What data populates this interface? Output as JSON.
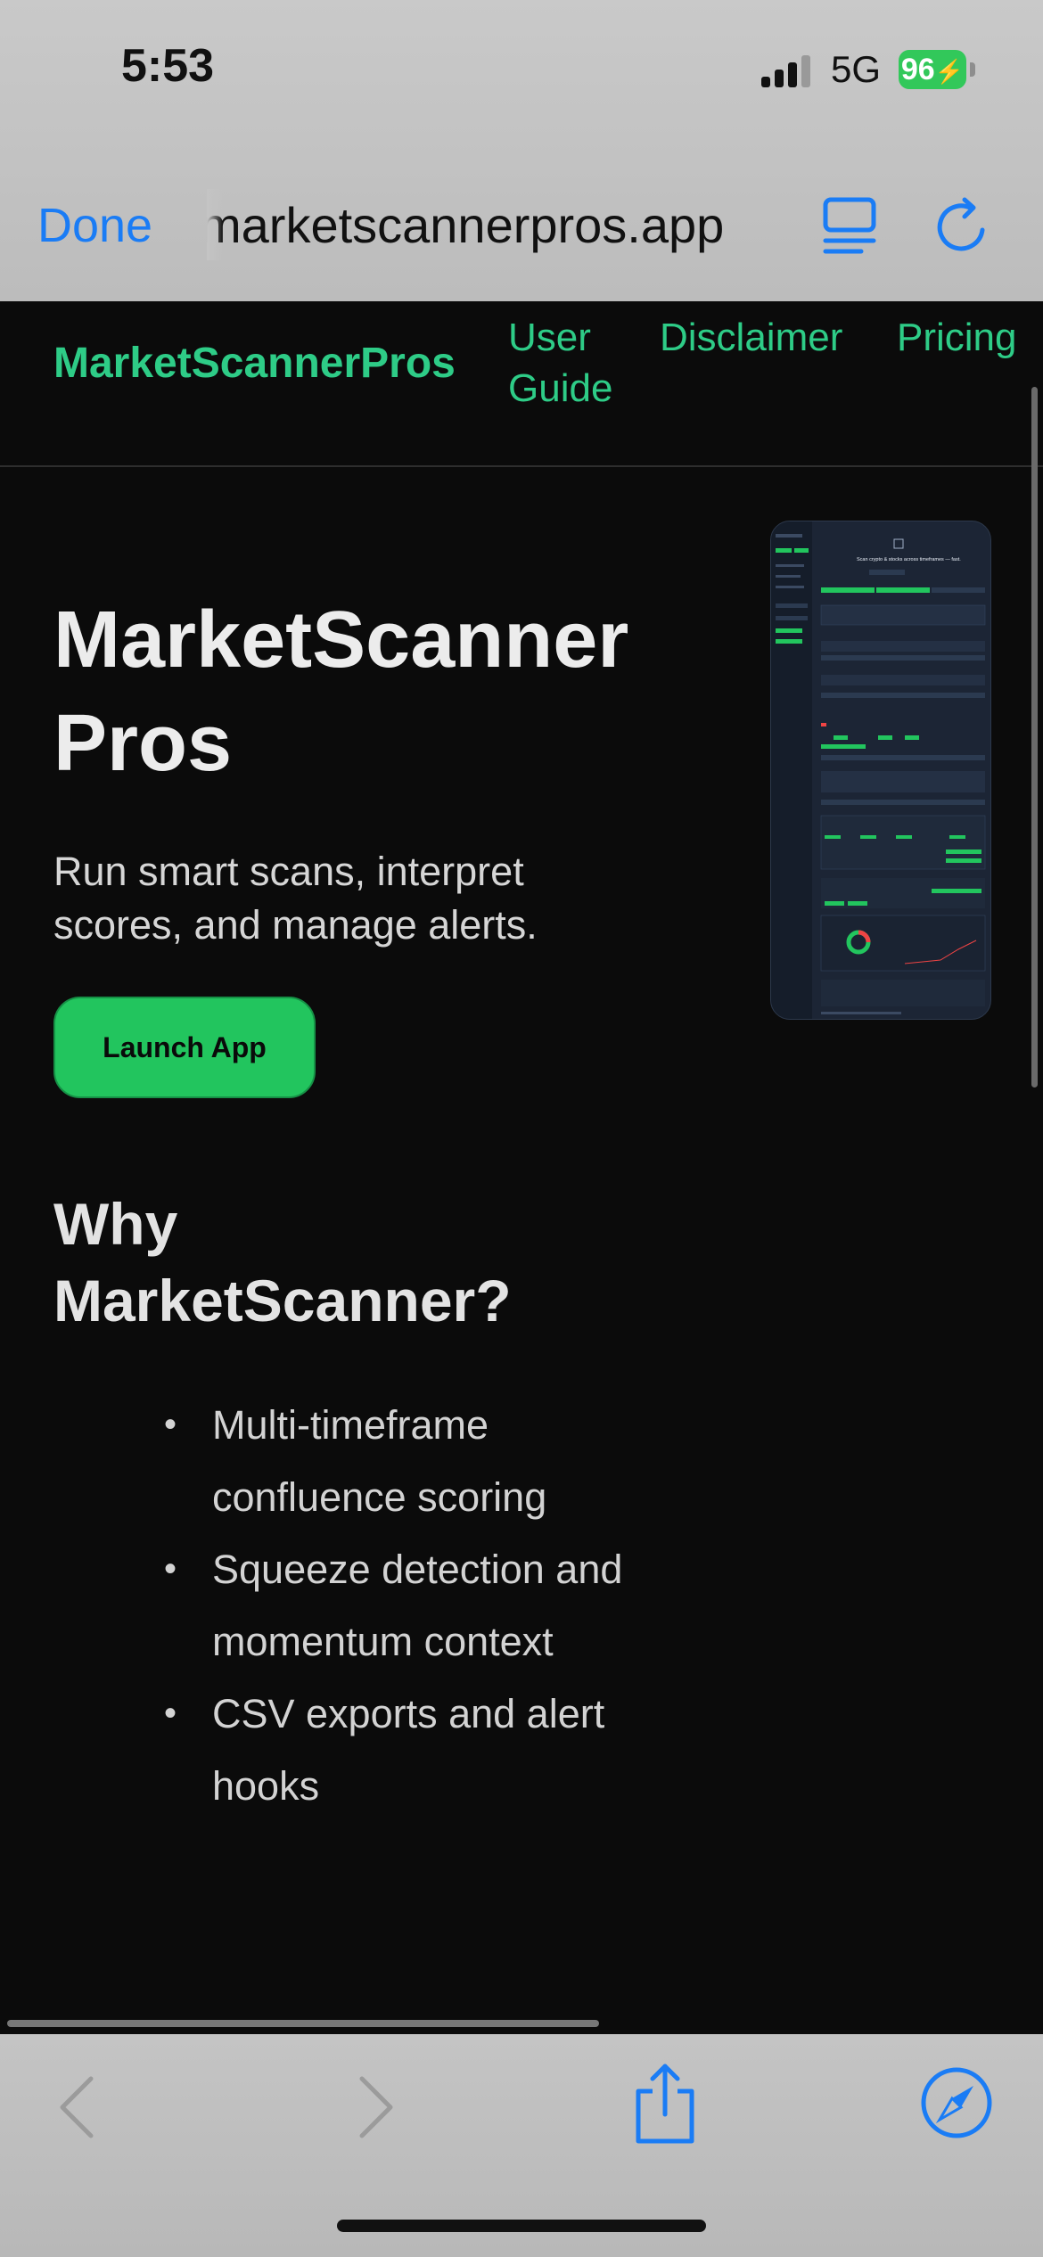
{
  "status_bar": {
    "time": "5:53",
    "network": "5G",
    "battery": "96"
  },
  "browser": {
    "done_label": "Done",
    "url": "marketscannerpros.app"
  },
  "site": {
    "brand": "MarketScannerPros",
    "nav": [
      {
        "label_line1": "User",
        "label_line2": "Guide"
      },
      {
        "label": "Disclaimer"
      },
      {
        "label": "Pricing"
      }
    ],
    "hero": {
      "title_line1": "MarketScanner",
      "title_line2": "Pros",
      "subtitle": "Run smart scans, interpret scores, and manage alerts.",
      "cta": "Launch App"
    },
    "why": {
      "title_line1": "Why",
      "title_line2": "MarketScanner?",
      "features": [
        "Multi-timeframe confluence scoring",
        "Squeeze detection and momentum context",
        "CSV exports and alert hooks"
      ]
    },
    "preview": {
      "headline": "Scan crypto & stocks across timeframes — fast."
    }
  },
  "colors": {
    "accent_green": "#2ecc87",
    "button_green": "#22c55e",
    "safari_blue": "#1a7cf5"
  },
  "icons": [
    "reader-icon",
    "reload-icon",
    "back-icon",
    "forward-icon",
    "share-icon",
    "compass-icon"
  ]
}
